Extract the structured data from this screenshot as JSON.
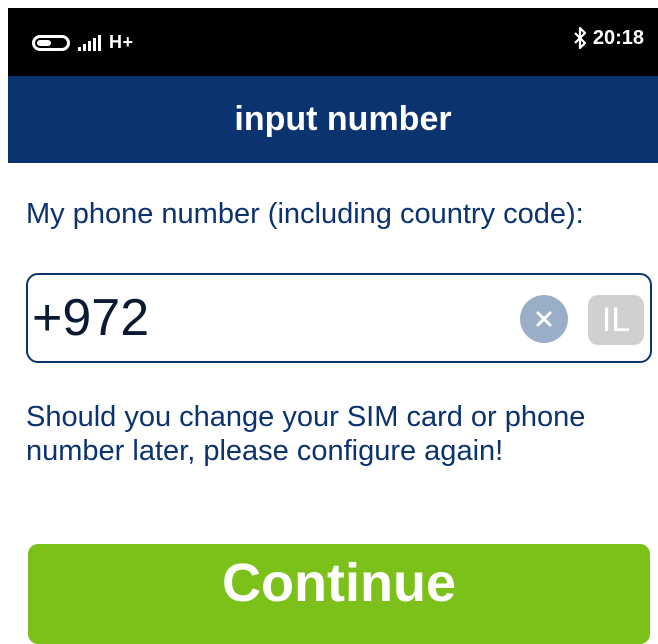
{
  "status_bar": {
    "network_type": "H+",
    "time": "20:18",
    "icons": [
      "toggle-icon",
      "signal-icon",
      "bluetooth-icon"
    ]
  },
  "header": {
    "title": "input number"
  },
  "form": {
    "prompt": "My phone number (including country code):",
    "phone_value": "+972",
    "country_code": "IL",
    "clear_icon": "close-icon"
  },
  "notice": "Should you change your SIM card or phone number later, please configure again!",
  "continue_label": "Continue",
  "colors": {
    "header_background": "#0b3370",
    "text_primary": "#0b3370",
    "button_background": "#7cc11a",
    "clear_background": "#9aaec8",
    "badge_background": "#d0d0d0"
  }
}
